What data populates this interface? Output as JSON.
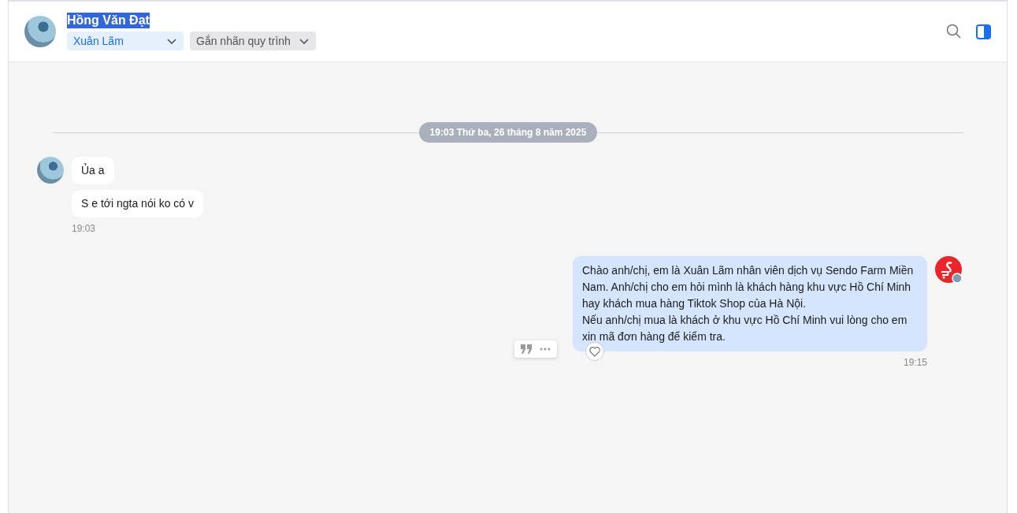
{
  "header": {
    "name": "Hồng Văn Đạt",
    "name_highlighted": true,
    "assignee": "Xuân Lãm",
    "tag_placeholder": "Gắn nhãn quy trình"
  },
  "date_divider": "19:03 Thứ ba, 26 tháng 8 năm 2025",
  "messages": [
    {
      "kind": "incoming",
      "bubbles": [
        "Ủa a",
        "S e tới ngta nói ko có v"
      ],
      "time": "19:03"
    },
    {
      "kind": "outgoing",
      "bubbles": [
        "Chào anh/chị, em là Xuân Lãm nhân viên dịch vụ Sendo Farm Miền Nam. Anh/chị cho em hỏi mình là khách hàng khu vực Hồ Chí Minh hay khách mua hàng Tiktok Shop của Hà Nội.\nNếu anh/chị mua là khách ở khu vực Hồ Chí Minh vui lòng cho em xin mã đơn hàng để kiểm tra."
      ],
      "time": "19:15"
    }
  ]
}
